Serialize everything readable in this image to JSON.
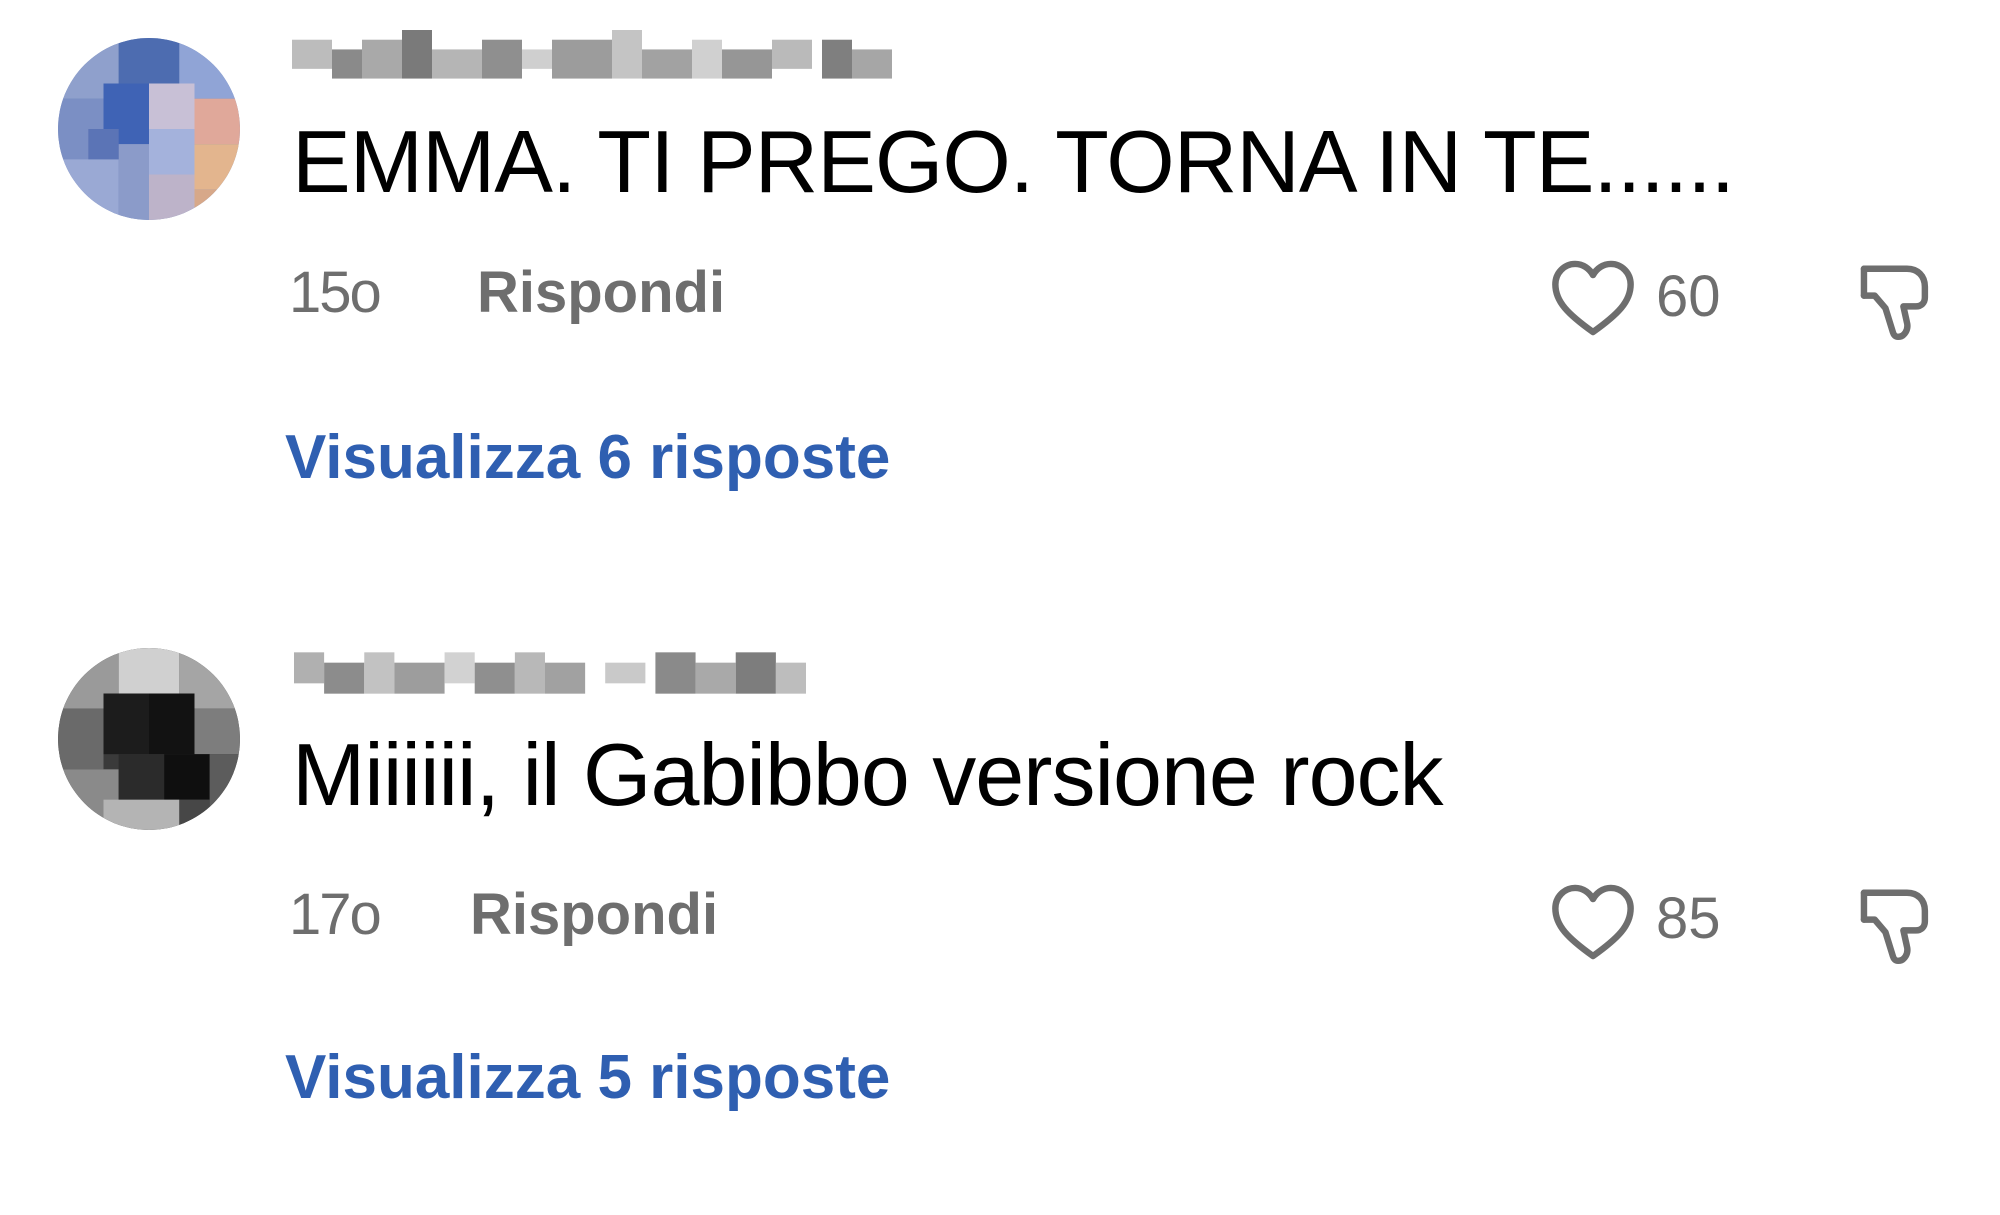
{
  "comments": [
    {
      "text": "EMMA. TI PREGO. TORNA IN TE......",
      "time": "15o",
      "reply_label": "Rispondi",
      "likes": "60",
      "view_replies": "Visualizza 6 risposte"
    },
    {
      "text": "Miiiiii, il Gabibbo versione rock",
      "time": "17o",
      "reply_label": "Rispondi",
      "likes": "85",
      "view_replies": "Visualizza 5 risposte"
    }
  ],
  "icons": {
    "like": "heart-outline-icon",
    "dislike": "thumbs-down-outline-icon"
  },
  "colors": {
    "text": "#000000",
    "meta": "#6e6e6e",
    "link": "#2f5fb1"
  }
}
